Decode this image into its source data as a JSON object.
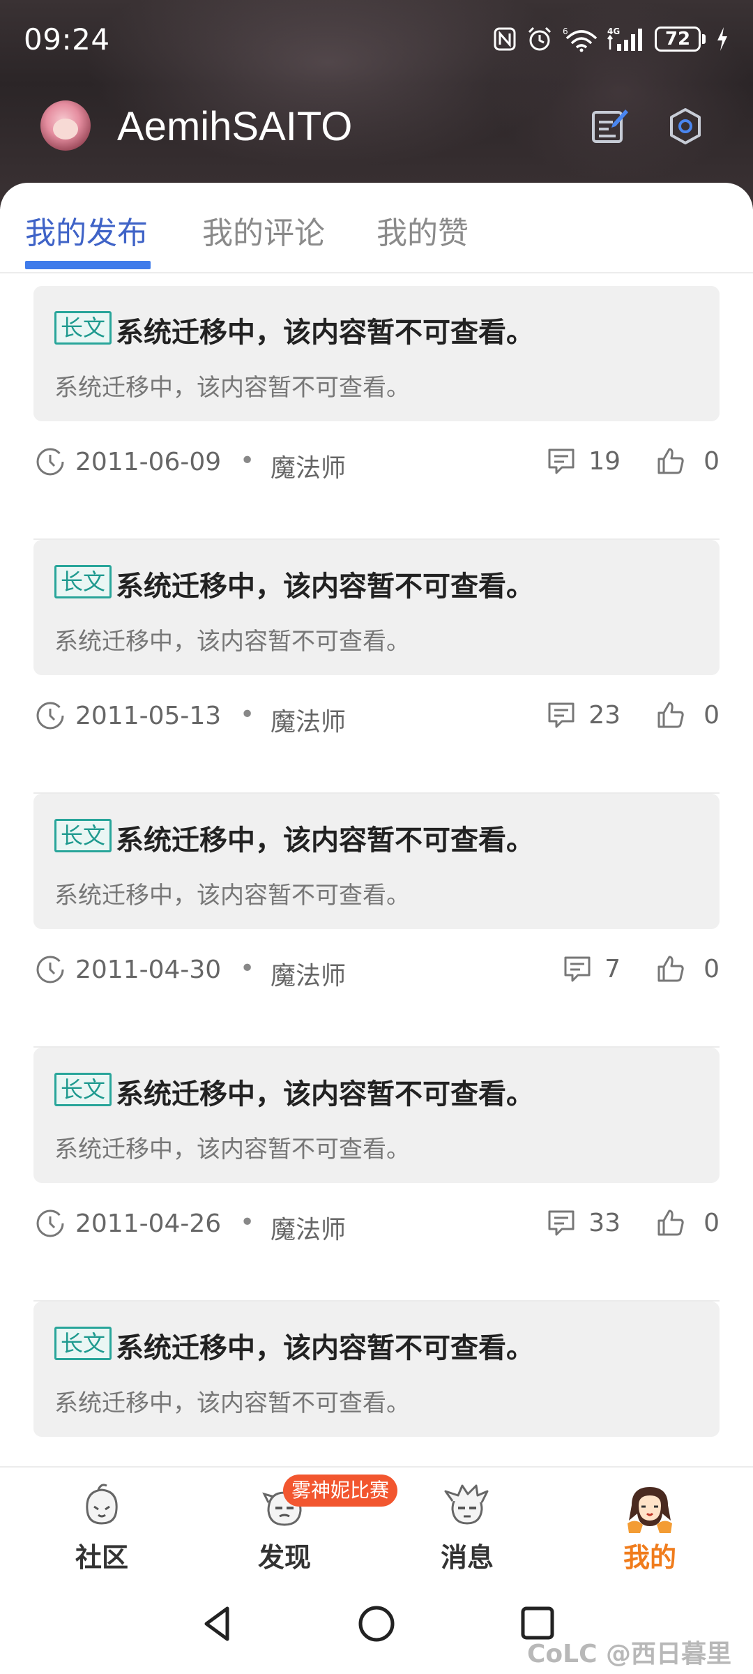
{
  "status_bar": {
    "time": "09:24",
    "network_label": "4G",
    "wifi_label": "6",
    "battery": "72"
  },
  "profile": {
    "username": "AemihSAITO"
  },
  "tabs": [
    {
      "label": "我的发布",
      "active": true
    },
    {
      "label": "我的评论",
      "active": false
    },
    {
      "label": "我的赞",
      "active": false
    }
  ],
  "posts": [
    {
      "tag": "长文",
      "title": "系统迁移中，该内容暂不可查看。",
      "excerpt": "系统迁移中，该内容暂不可查看。",
      "date": "2011-06-09",
      "dot": "•",
      "author": "魔法师",
      "comments": "19",
      "likes": "0"
    },
    {
      "tag": "长文",
      "title": "系统迁移中，该内容暂不可查看。",
      "excerpt": "系统迁移中，该内容暂不可查看。",
      "date": "2011-05-13",
      "dot": "•",
      "author": "魔法师",
      "comments": "23",
      "likes": "0"
    },
    {
      "tag": "长文",
      "title": "系统迁移中，该内容暂不可查看。",
      "excerpt": "系统迁移中，该内容暂不可查看。",
      "date": "2011-04-30",
      "dot": "•",
      "author": "魔法师",
      "comments": "7",
      "likes": "0"
    },
    {
      "tag": "长文",
      "title": "系统迁移中，该内容暂不可查看。",
      "excerpt": "系统迁移中，该内容暂不可查看。",
      "date": "2011-04-26",
      "dot": "•",
      "author": "魔法师",
      "comments": "33",
      "likes": "0"
    },
    {
      "tag": "长文",
      "title": "系统迁移中，该内容暂不可查看。",
      "excerpt": "系统迁移中，该内容暂不可查看。"
    }
  ],
  "bottom_nav": [
    {
      "label": "社区",
      "icon": "community-mascot-icon",
      "active": false
    },
    {
      "label": "发现",
      "icon": "discover-mascot-icon",
      "active": false,
      "badge": "雾神妮比赛"
    },
    {
      "label": "消息",
      "icon": "message-mascot-icon",
      "active": false
    },
    {
      "label": "我的",
      "icon": "profile-mascot-icon",
      "active": true
    }
  ],
  "watermark": "CoLC @西日暮里",
  "colors": {
    "accent": "#3f63c7",
    "tag": "#1f9a8f",
    "active_nav": "#f07c1c",
    "badge": "#f2562f"
  }
}
